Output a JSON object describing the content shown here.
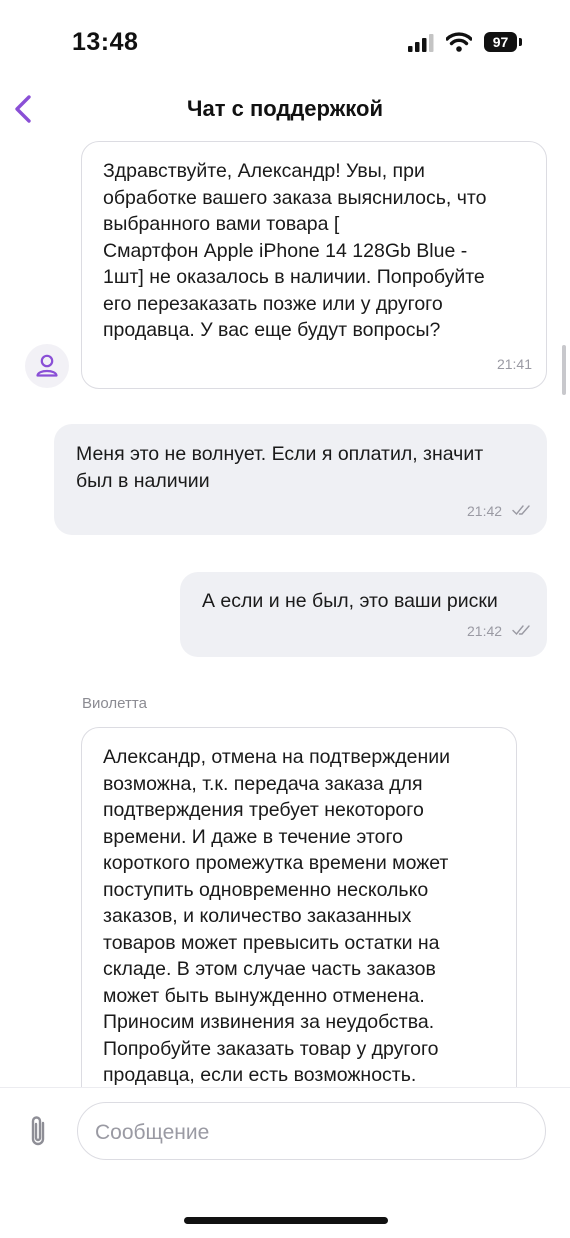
{
  "status_bar": {
    "time": "13:48",
    "battery": "97"
  },
  "header": {
    "title": "Чат с поддержкой"
  },
  "messages": [
    {
      "direction": "incoming",
      "text": "Здравствуйте, Александр!  Увы, при\nобработке вашего заказа выяснилось, что\nвыбранного вами товара [\nСмартфон Apple iPhone 14 128Gb Blue -\n1шт] не оказалось в наличии. Попробуйте\nего перезаказать позже или у другого\nпродавца. У вас еще будут вопросы?",
      "time": "21:41"
    },
    {
      "direction": "outgoing",
      "text": "Меня это не волнует. Если я оплатил, значит\nбыл в наличии",
      "time": "21:42"
    },
    {
      "direction": "outgoing",
      "text": "А если и не был, это ваши риски",
      "time": "21:42"
    },
    {
      "direction": "incoming",
      "sender": "Виолетта",
      "text": "Александр, отмена на подтверждении\nвозможна, т.к. передача заказа для\nподтверждения требует некоторого\nвремени. И даже в течение этого\nкороткого промежутка времени может\nпоступить одновременно несколько\nзаказов, и количество заказанных\nтоваров может превысить остатки на\nскладе. В этом случае часть заказов\nможет быть вынужденно отменена.\nПриносим извинения за неудобства.\nПопробуйте заказать товар у другого\nпродавца, если есть возможность."
    }
  ],
  "composer": {
    "placeholder": "Сообщение"
  },
  "colors": {
    "accent": "#8a4fd6",
    "outgoing_bubble": "#eff0f4",
    "incoming_border": "#dcdce2"
  },
  "icons": [
    "back-arrow-icon",
    "cellular-signal-icon",
    "wifi-icon",
    "battery-icon",
    "user-avatar-icon",
    "double-check-icon",
    "paperclip-icon"
  ]
}
